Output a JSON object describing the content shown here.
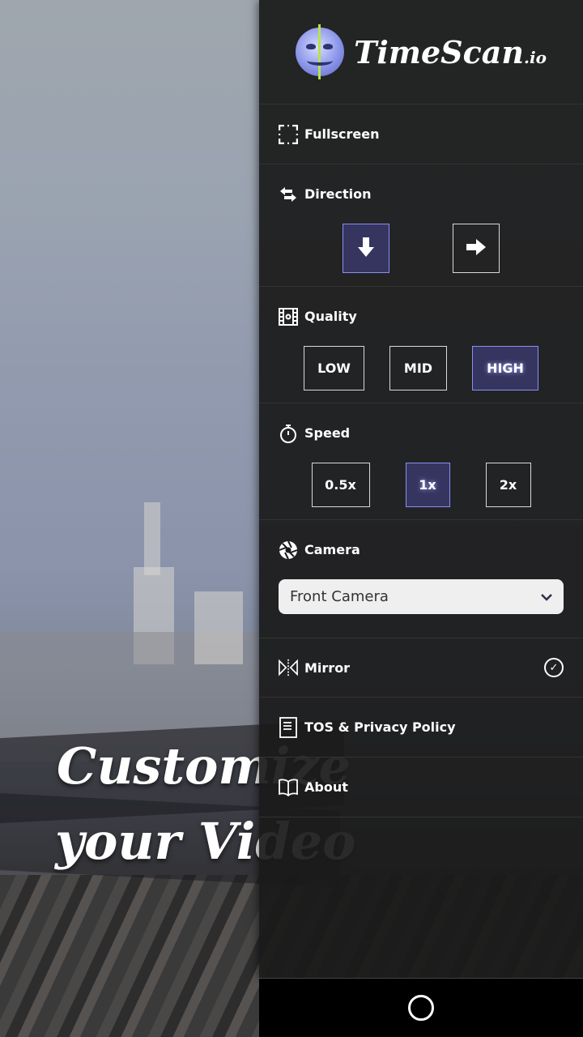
{
  "app": {
    "name": "TimeScan",
    "suffix": ".io"
  },
  "promo": {
    "line1": "Customize",
    "line2": "your Video"
  },
  "menu": {
    "fullscreen": {
      "label": "Fullscreen",
      "icon": "fullscreen-icon"
    },
    "direction": {
      "label": "Direction",
      "icon": "swap-arrows-icon",
      "options": [
        {
          "icon": "arrow-down-icon",
          "selected": true
        },
        {
          "icon": "arrow-right-icon",
          "selected": false
        }
      ]
    },
    "quality": {
      "label": "Quality",
      "icon": "film-icon",
      "options": [
        "LOW",
        "MID",
        "HIGH"
      ],
      "selected": "HIGH"
    },
    "speed": {
      "label": "Speed",
      "icon": "stopwatch-icon",
      "options": [
        "0.5x",
        "1x",
        "2x"
      ],
      "selected": "1x"
    },
    "camera": {
      "label": "Camera",
      "icon": "aperture-icon",
      "value": "Front Camera"
    },
    "mirror": {
      "label": "Mirror",
      "icon": "mirror-icon",
      "checked": true
    },
    "tos": {
      "label": "TOS & Privacy Policy",
      "icon": "document-icon"
    },
    "about": {
      "label": "About",
      "icon": "book-icon"
    }
  },
  "colors": {
    "panel": "#1a1a1a",
    "selected_bg": "#353560",
    "selected_border": "#8a8ff0"
  }
}
